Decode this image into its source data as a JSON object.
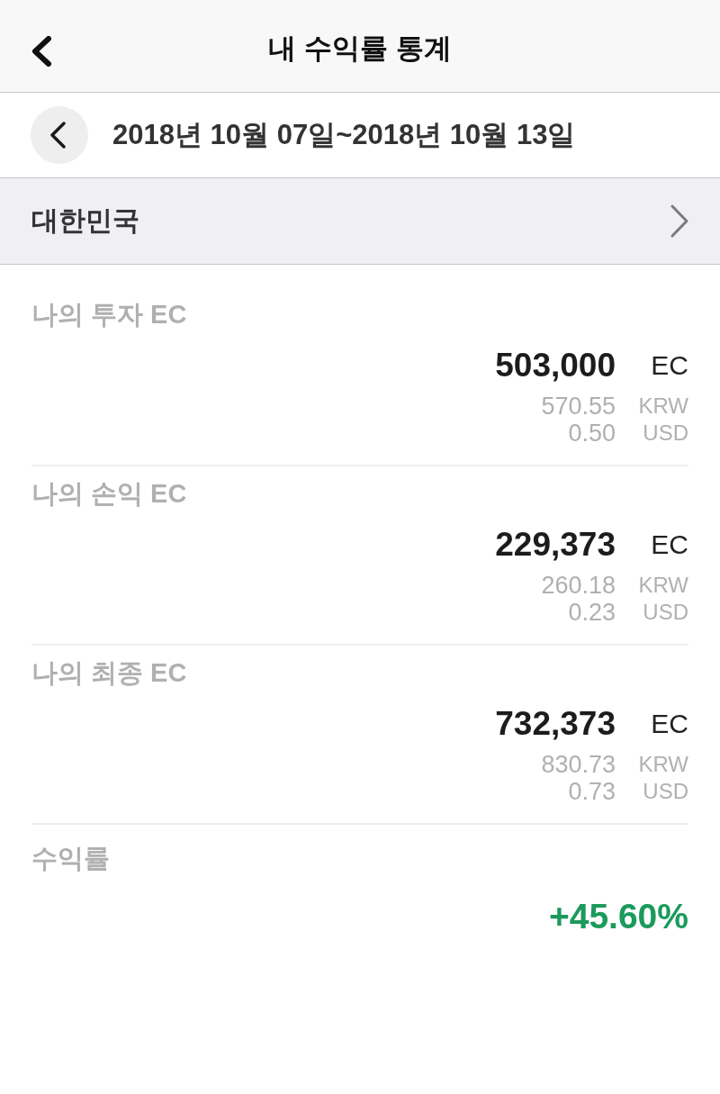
{
  "header": {
    "title": "내 수익률 통계"
  },
  "date_range": {
    "text": "2018년 10월 07일~2018년 10월 13일"
  },
  "region": {
    "label": "대한민국"
  },
  "stats": [
    {
      "label": "나의 투자 EC",
      "value": "503,000",
      "unit": "EC",
      "conversions": [
        {
          "amount": "570.55",
          "currency": "KRW"
        },
        {
          "amount": "0.50",
          "currency": "USD"
        }
      ]
    },
    {
      "label": "나의 손익 EC",
      "value": "229,373",
      "unit": "EC",
      "conversions": [
        {
          "amount": "260.18",
          "currency": "KRW"
        },
        {
          "amount": "0.23",
          "currency": "USD"
        }
      ]
    },
    {
      "label": "나의 최종 EC",
      "value": "732,373",
      "unit": "EC",
      "conversions": [
        {
          "amount": "830.73",
          "currency": "KRW"
        },
        {
          "amount": "0.73",
          "currency": "USD"
        }
      ]
    }
  ],
  "return_rate": {
    "label": "수익률",
    "value": "+45.60%",
    "positive": true
  }
}
